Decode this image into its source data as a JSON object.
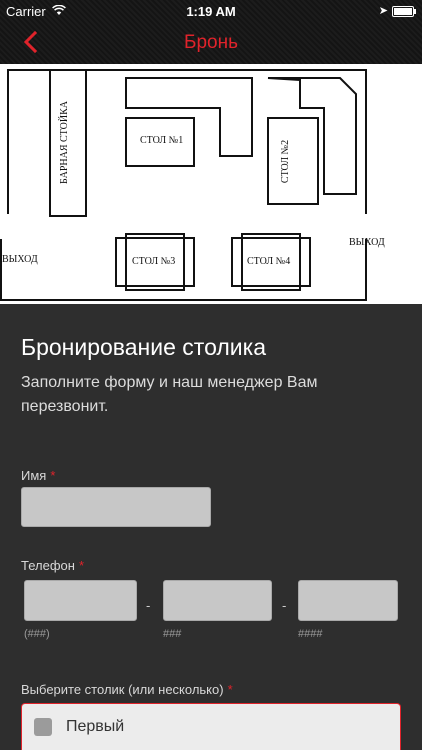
{
  "status_bar": {
    "carrier": "Carrier",
    "time": "1:19 AM"
  },
  "nav": {
    "title": "Бронь",
    "accent_color": "#e0232b"
  },
  "floor_plan": {
    "bar": "БАРНАЯ СТОЙКА",
    "table1": "СТОЛ №1",
    "table2": "СТОЛ №2",
    "table3": "СТОЛ №3",
    "table4": "СТОЛ №4",
    "exit_left": "ВЫХОД",
    "exit_right": "ВЫХОД"
  },
  "form": {
    "title": "Бронирование столика",
    "subtitle": "Заполните форму и наш менеджер Вам перезвонит.",
    "name_label": "Имя",
    "phone_label": "Телефон",
    "required_mark": "*",
    "phone_sep1": "-",
    "phone_sep2": "-",
    "phone_hint1": "(###)",
    "phone_hint2": "###",
    "phone_hint3": "####",
    "table_label": "Выберите столик (или несколько)",
    "table_options": [
      "Первый"
    ]
  }
}
